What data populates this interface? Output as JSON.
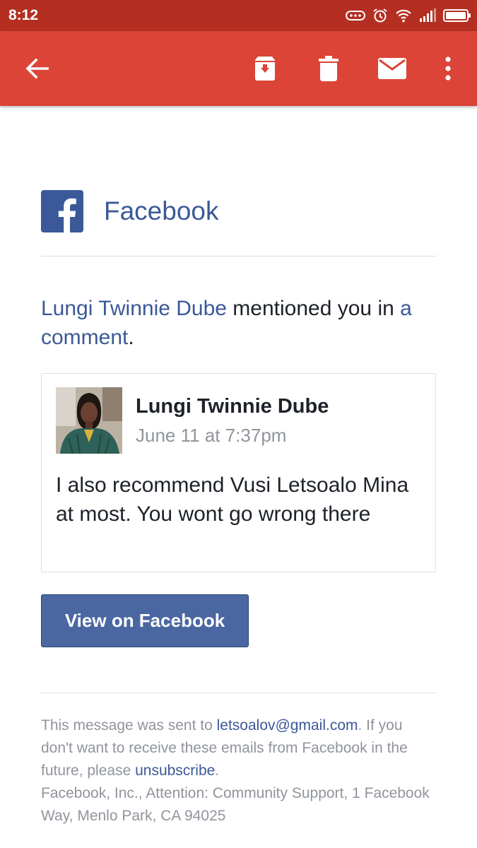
{
  "status_bar": {
    "time": "8:12",
    "icons": [
      "more-dots-icon",
      "alarm-icon",
      "wifi-icon",
      "signal-icon",
      "battery-icon"
    ]
  },
  "toolbar": {
    "back_icon": "arrow-back-icon",
    "actions": [
      "archive-icon",
      "trash-icon",
      "mail-icon",
      "more-vert-icon"
    ],
    "background_color": "#db4437",
    "status_color": "#b42f22"
  },
  "email": {
    "brand": {
      "name": "Facebook",
      "logo_icon": "facebook-logo-icon",
      "color": "#3b5998"
    },
    "headline": {
      "actor": "Lungi Twinnie Dube",
      "action": " mentioned you in ",
      "link_text": "a comment",
      "end": "."
    },
    "comment_card": {
      "author": "Lungi Twinnie Dube",
      "timestamp": "June 11 at 7:37pm",
      "text": "I also recommend Vusi Letsoalo Mina at most. You wont go wrong there"
    },
    "button_label": "View on Facebook",
    "footer": {
      "sent_prefix": "This message was sent to ",
      "email": "letsoalov@gmail.com",
      "sent_suffix": ". If you don't want to receive these emails from Facebook in the future, please ",
      "unsubscribe": "unsubscribe",
      "period": ".",
      "address": "Facebook, Inc., Attention: Community Support, 1 Facebook Way, Menlo Park, CA 94025"
    }
  }
}
